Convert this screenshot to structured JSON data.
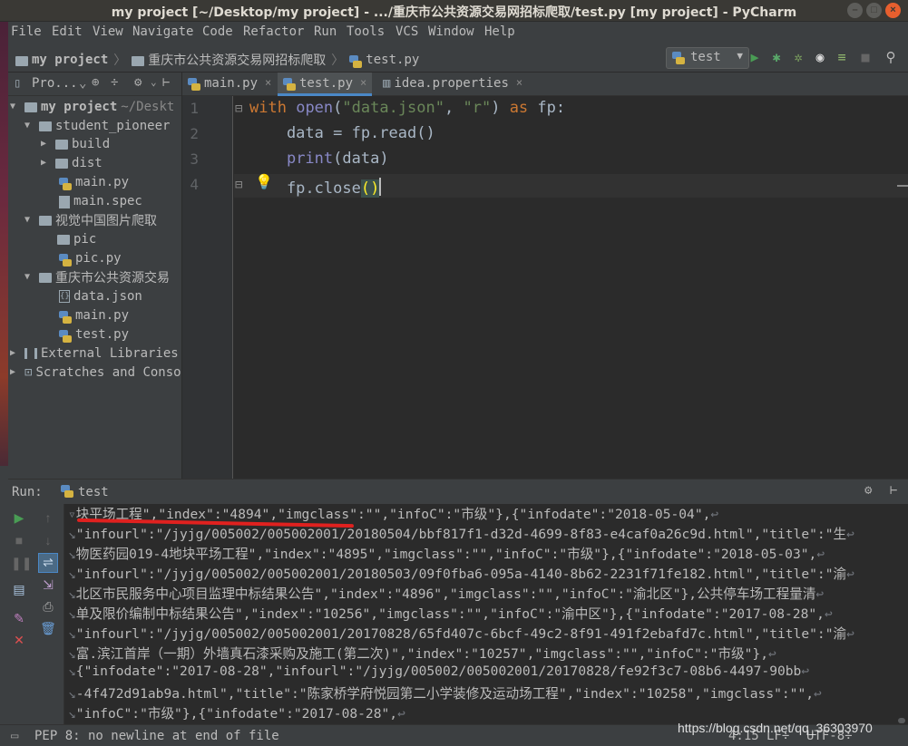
{
  "window": {
    "title": "my project [~/Desktop/my project] - .../重庆市公共资源交易网招标爬取/test.py [my project] - PyCharm"
  },
  "menu": [
    "File",
    "Edit",
    "View",
    "Navigate",
    "Code",
    "Refactor",
    "Run",
    "Tools",
    "VCS",
    "Window",
    "Help"
  ],
  "breadcrumb": {
    "project": "my project",
    "folder": "重庆市公共资源交易网招标爬取",
    "file": "test.py"
  },
  "run_config": {
    "name": "test"
  },
  "project_panel": {
    "header": "Pro...",
    "tree": [
      {
        "label": "my project",
        "suffix": "~/Deskt"
      },
      {
        "label": "student_pioneer"
      },
      {
        "label": "build"
      },
      {
        "label": "dist"
      },
      {
        "label": "main.py"
      },
      {
        "label": "main.spec"
      },
      {
        "label": "视觉中国图片爬取"
      },
      {
        "label": "pic"
      },
      {
        "label": "pic.py"
      },
      {
        "label": "重庆市公共资源交易"
      },
      {
        "label": "data.json"
      },
      {
        "label": "main.py"
      },
      {
        "label": "test.py"
      },
      {
        "label": "External Libraries"
      },
      {
        "label": "Scratches and Conso"
      }
    ]
  },
  "tabs": [
    {
      "label": "main.py"
    },
    {
      "label": "test.py"
    },
    {
      "label": "idea.properties"
    }
  ],
  "editor": {
    "line_numbers": [
      "1",
      "2",
      "3",
      "4"
    ],
    "line1": {
      "kw_with": "with",
      "fn_open": "open",
      "p1": "(",
      "s1": "\"data.json\"",
      "comma": ", ",
      "s2": "\"r\"",
      "p2": ") ",
      "kw_as": "as",
      "rest": " fp:"
    },
    "line2": {
      "text": "    data = fp.read()"
    },
    "line3": {
      "indent": "    ",
      "fn_print": "print",
      "rest": "(data)"
    },
    "line4": {
      "text": "    fp.close",
      "brace": "()"
    }
  },
  "run_panel": {
    "label": "Run:",
    "tab": "test",
    "console_lines": [
      "块平场工程\",\"index\":\"4894\",\"imgclass\":\"\",\"infoC\":\"市级\"},{\"infodate\":\"2018-05-04\",",
      "\"infourl\":\"/jyjg/005002/005002001/20180504/bbf817f1-d32d-4699-8f83-e4caf0a26c9d.html\",\"title\":\"生",
      "物医药园019-4地块平场工程\",\"index\":\"4895\",\"imgclass\":\"\",\"infoC\":\"市级\"},{\"infodate\":\"2018-05-03\",",
      "\"infourl\":\"/jyjg/005002/005002001/20180503/09f0fba6-095a-4140-8b62-2231f71fe182.html\",\"title\":\"渝",
      "北区市民服务中心项目监理中标结果公告\",\"index\":\"4896\",\"imgclass\":\"\",\"infoC\":\"渝北区\"},公共停车场工程量清",
      "单及限价编制中标结果公告\",\"index\":\"10256\",\"imgclass\":\"\",\"infoC\":\"渝中区\"},{\"infodate\":\"2017-08-28\",",
      "\"infourl\":\"/jyjg/005002/005002001/20170828/65fd407c-6bcf-49c2-8f91-491f2ebafd7c.html\",\"title\":\"渝",
      "富.滨江首岸（一期）外墙真石漆采购及施工(第二次)\",\"index\":\"10257\",\"imgclass\":\"\",\"infoC\":\"市级\"},",
      "{\"infodate\":\"2017-08-28\",\"infourl\":\"/jyjg/005002/005002001/20170828/fe92f3c7-08b6-4497-90bb",
      "-4f472d91ab9a.html\",\"title\":\"陈家桥学府悦园第二小学装修及运动场工程\",\"index\":\"10258\",\"imgclass\":\"\",",
      "\"infoC\":\"市级\"},{\"infodate\":\"2017-08-28\","
    ]
  },
  "status": {
    "message": "PEP 8: no newline at end of file",
    "position": "4:15",
    "line_sep": "LF÷",
    "encoding": "UTF-8÷",
    "watermark": "https://blog.csdn.net/qq_36303970"
  },
  "colors": {
    "accent": "#4a88c7",
    "keyword": "#cc7832",
    "string": "#6a8759",
    "builtin": "#8888c6",
    "run_green": "#499c54"
  }
}
